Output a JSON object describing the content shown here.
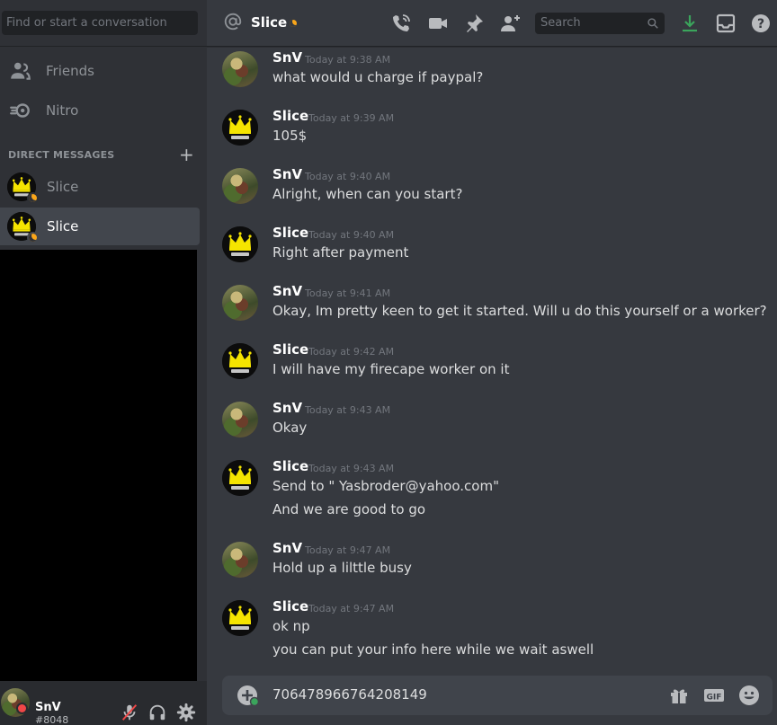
{
  "sidebar": {
    "search_placeholder": "Find or start a conversation",
    "nav": [
      {
        "label": "Friends"
      },
      {
        "label": "Nitro"
      }
    ],
    "dm_header": "DIRECT MESSAGES",
    "dms": [
      {
        "name": "Slice",
        "active": false
      },
      {
        "name": "Slice",
        "active": true
      }
    ]
  },
  "user": {
    "name": "SnV",
    "tag": "#8048"
  },
  "header": {
    "channel": "Slice",
    "search_placeholder": "Search"
  },
  "messages": [
    {
      "author": "SnV",
      "time": "Today at 9:38 AM",
      "lines": [
        "what would u charge if paypal?"
      ],
      "avatar": "photo"
    },
    {
      "author": "Slice",
      "time": "Today at 9:39 AM",
      "lines": [
        "105$"
      ],
      "avatar": "crown"
    },
    {
      "author": "SnV",
      "time": "Today at 9:40 AM",
      "lines": [
        "Alright, when can you start?"
      ],
      "avatar": "photo"
    },
    {
      "author": "Slice",
      "time": "Today at 9:40 AM",
      "lines": [
        "Right after payment"
      ],
      "avatar": "crown"
    },
    {
      "author": "SnV",
      "time": "Today at 9:41 AM",
      "lines": [
        "Okay, Im pretty keen to get it started. Will u do this yourself or a worker?"
      ],
      "avatar": "photo"
    },
    {
      "author": "Slice",
      "time": "Today at 9:42 AM",
      "lines": [
        "I will have my firecape worker on it"
      ],
      "avatar": "crown"
    },
    {
      "author": "SnV",
      "time": "Today at 9:43 AM",
      "lines": [
        "Okay"
      ],
      "avatar": "photo"
    },
    {
      "author": "Slice",
      "time": "Today at 9:43 AM",
      "lines": [
        "Send to \" Yasbroder@yahoo.com\"",
        "And we are good to go"
      ],
      "avatar": "crown"
    },
    {
      "author": "SnV",
      "time": "Today at 9:47 AM",
      "lines": [
        "Hold up a lilttle busy"
      ],
      "avatar": "photo"
    },
    {
      "author": "Slice",
      "time": "Today at 9:47 AM",
      "lines": [
        "ok np",
        "you can put your info here while we wait aswell"
      ],
      "avatar": "crown"
    }
  ],
  "composer": {
    "value": "706478966764208149",
    "gif_label": "GIF"
  },
  "colors": {
    "accent_status_idle": "#faa61a",
    "status_dnd": "#f04747",
    "download_green": "#3ba55c"
  }
}
